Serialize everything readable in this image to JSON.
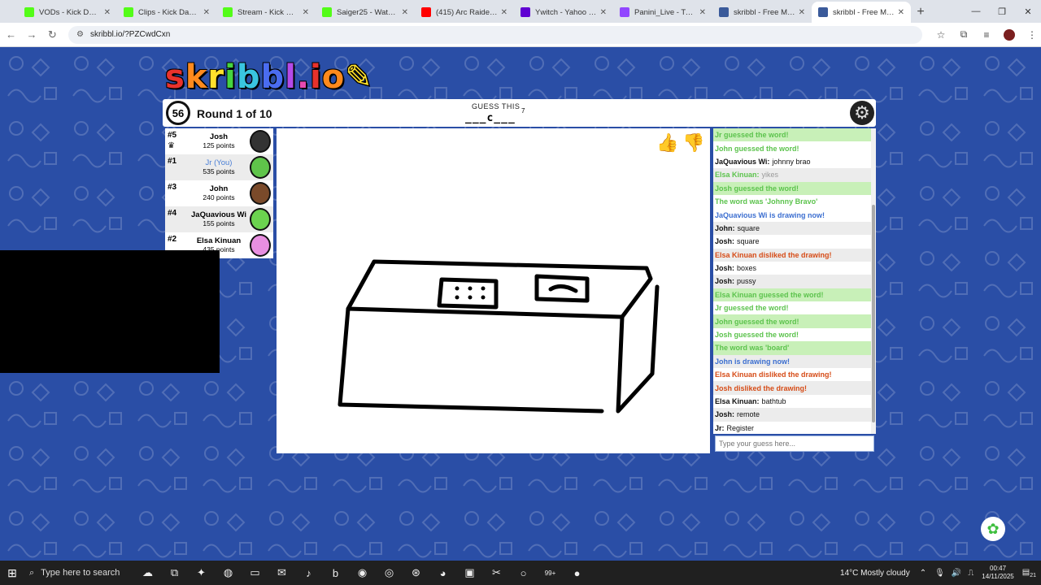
{
  "browser": {
    "tabs": [
      {
        "title": "VODs - Kick Dashboard",
        "color": "#53fc18"
      },
      {
        "title": "Clips - Kick Dashboard",
        "color": "#53fc18"
      },
      {
        "title": "Stream - Kick Dashboard",
        "color": "#53fc18"
      },
      {
        "title": "Saiger25 - Watch the",
        "color": "#53fc18"
      },
      {
        "title": "(415) Arc Raiders - Ul",
        "color": "#ff0000"
      },
      {
        "title": "Ywitch - Yahoo Search",
        "color": "#6001d2"
      },
      {
        "title": "Panini_Live - Twitch",
        "color": "#9146ff"
      },
      {
        "title": "skribbl - Free Multipl",
        "color": "#3a5a9a"
      },
      {
        "title": "skribbl - Free Multipl",
        "color": "#3a5a9a"
      }
    ],
    "new_tab": "+",
    "url": "skribbl.io/?PZCwdCxn"
  },
  "game": {
    "logo": "skribbl.io",
    "timer": "56",
    "round": "Round 1 of 10",
    "guess_label": "GUESS THIS",
    "word_hint": "___c___",
    "word_length": "7",
    "players": [
      {
        "rank": "#5",
        "name": "Josh",
        "points": "125 points",
        "you": false,
        "face_color": "#333333",
        "crown": true
      },
      {
        "rank": "#1",
        "name": "Jr (You)",
        "points": "535 points",
        "you": true,
        "face_color": "#5fc44a",
        "crown": false
      },
      {
        "rank": "#3",
        "name": "John",
        "points": "240 points",
        "you": false,
        "face_color": "#7a4a2a",
        "crown": false
      },
      {
        "rank": "#4",
        "name": "JaQuavious Wi",
        "points": "155 points",
        "you": false,
        "face_color": "#6bd34f",
        "crown": false
      },
      {
        "rank": "#2",
        "name": "Elsa Kinuan",
        "points": "435 points",
        "you": false,
        "face_color": "#e88fe0",
        "crown": false
      }
    ],
    "chat": [
      {
        "type": "green",
        "text": "Jr guessed the word!"
      },
      {
        "type": "green2",
        "text": "John guessed the word!"
      },
      {
        "type": "msg",
        "name": "JaQuavious Wi:",
        "text": "johnny brao"
      },
      {
        "type": "green-muted",
        "name": "Elsa Kinuan:",
        "text": "yikes"
      },
      {
        "type": "green",
        "text": "Josh guessed the word!"
      },
      {
        "type": "green2",
        "text": "The word was 'Johnny Bravo'"
      },
      {
        "type": "blue",
        "text": "JaQuavious Wi is drawing now!"
      },
      {
        "type": "msg",
        "name": "John:",
        "text": "square"
      },
      {
        "type": "msg",
        "name": "Josh:",
        "text": "square"
      },
      {
        "type": "red",
        "text": "Elsa Kinuan disliked the drawing!"
      },
      {
        "type": "msg",
        "name": "Josh:",
        "text": "boxes"
      },
      {
        "type": "msg",
        "name": "Josh:",
        "text": "pussy"
      },
      {
        "type": "green",
        "text": "Elsa Kinuan guessed the word!"
      },
      {
        "type": "green2",
        "text": "Jr guessed the word!"
      },
      {
        "type": "green",
        "text": "John guessed the word!"
      },
      {
        "type": "green2",
        "text": "Josh guessed the word!"
      },
      {
        "type": "green",
        "text": "The word was 'board'"
      },
      {
        "type": "blue",
        "text": "John is drawing now!"
      },
      {
        "type": "red",
        "text": "Elsa Kinuan disliked the drawing!"
      },
      {
        "type": "red",
        "text": "Josh disliked the drawing!"
      },
      {
        "type": "msg",
        "name": "Elsa Kinuan:",
        "text": "bathtub"
      },
      {
        "type": "msg",
        "name": "Josh:",
        "text": "remote"
      },
      {
        "type": "msg",
        "name": "Jr:",
        "text": "Register"
      }
    ],
    "guess_placeholder": "Type your guess here..."
  },
  "taskbar": {
    "search_placeholder": "Type here to search",
    "weather": "14°C  Mostly cloudy",
    "time": "00:47",
    "date": "14/11/2025",
    "badge": "99+",
    "notif_count": "21"
  }
}
